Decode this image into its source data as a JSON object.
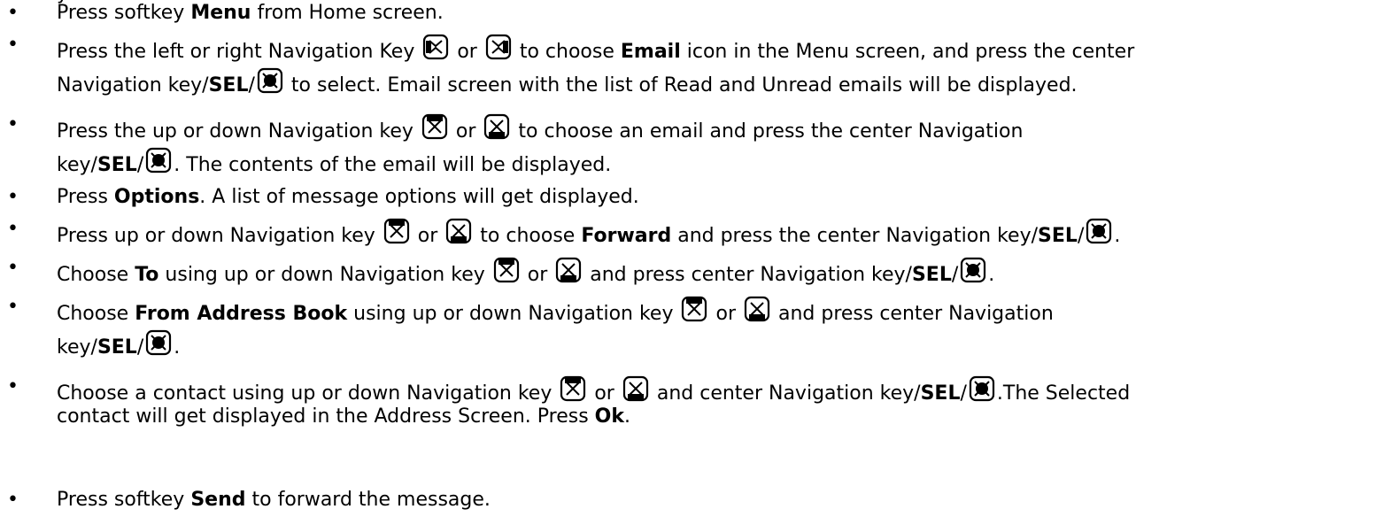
{
  "top_fragment": "y",
  "icons": {
    "nav_left": "nav-left-key-icon",
    "nav_right": "nav-right-key-icon",
    "nav_up": "nav-up-key-icon",
    "nav_down": "nav-down-key-icon",
    "nav_center": "nav-center-key-icon"
  },
  "steps": {
    "s1": {
      "a": "Press softkey ",
      "b": "Menu",
      "c": " from Home screen."
    },
    "s2": {
      "a": "Press the left or right Navigation Key ",
      "or": " or ",
      "b": " to choose ",
      "c": "Email",
      "d": " icon in the Menu screen, and press the center",
      "e": "Navigation key/",
      "f": "SEL",
      "g": "/",
      "h": " to select. Email screen with the list of Read and Unread emails will be displayed."
    },
    "s3": {
      "a": "Press the up or down Navigation key ",
      "or": " or ",
      "b": " to choose an email and press the center Navigation",
      "c": "key/",
      "d": "SEL",
      "e": "/",
      "f": ". The contents of the email will be displayed."
    },
    "s4": {
      "a": "Press ",
      "b": "Options",
      "c": ". A list of message options will get displayed."
    },
    "s5": {
      "a": "Press up or down Navigation key ",
      "or": " or ",
      "b": " to choose ",
      "c": "Forward",
      "d": " and press the center Navigation key/",
      "e": "SEL",
      "f": "/",
      "g": "."
    },
    "s6": {
      "a": "Choose ",
      "b": "To",
      "c": " using up or down Navigation key ",
      "or": " or ",
      "d": " and press center Navigation key/",
      "e": "SEL",
      "f": "/",
      "g": "."
    },
    "s7": {
      "a": "Choose ",
      "b": "From Address Book",
      "c": " using up or down Navigation key ",
      "or": " or ",
      "d": " and press center Navigation",
      "e": "key/",
      "f": "SEL",
      "g": "/",
      "h": "."
    },
    "s8": {
      "a": "Choose a contact using up or down Navigation key ",
      "or": " or ",
      "b": " and center Navigation key/",
      "c": "SEL",
      "d": "/",
      "e": ".The Selected",
      "f": "contact will get displayed in the Address Screen. Press ",
      "g": "Ok",
      "h": "."
    },
    "s9": {
      "a": "Press softkey ",
      "b": "Send",
      "c": " to forward the message."
    }
  }
}
